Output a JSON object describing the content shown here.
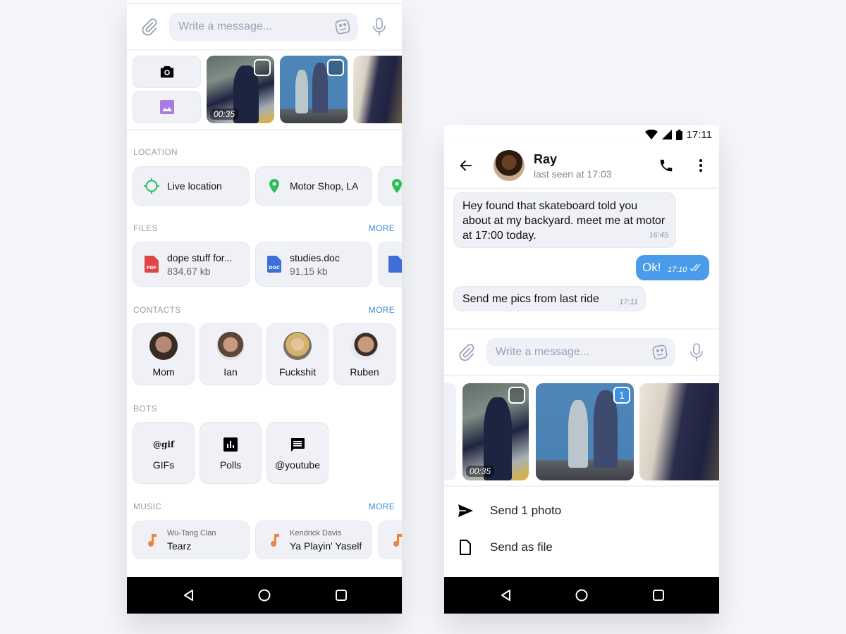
{
  "left_phone": {
    "composer": {
      "placeholder": "Write a message...",
      "attach_icon": "paperclip-icon",
      "sticker_icon": "sticker-icon",
      "mic_icon": "microphone-icon"
    },
    "media": {
      "camera_icon": "camera-icon",
      "gallery_icon": "image-icon",
      "thumbnails": [
        {
          "kind": "video",
          "duration": "00:35",
          "selected": false
        },
        {
          "kind": "photo",
          "selected": false
        },
        {
          "kind": "photo",
          "selected": false
        }
      ]
    },
    "location": {
      "title": "LOCATION",
      "items": [
        {
          "icon": "crosshair-icon",
          "label": "Live location"
        },
        {
          "icon": "map-pin-icon",
          "label": "Motor Shop, LA"
        }
      ]
    },
    "files": {
      "title": "FILES",
      "more": "MORE",
      "items": [
        {
          "icon": "pdf-file-icon",
          "type": "PDF",
          "name": "dope stuff for...",
          "size": "834,67 kb"
        },
        {
          "icon": "doc-file-icon",
          "type": "DOC",
          "name": "studies.doc",
          "size": "91,15 kb"
        }
      ]
    },
    "contacts": {
      "title": "CONTACTS",
      "more": "MORE",
      "items": [
        {
          "name": "Mom"
        },
        {
          "name": "Ian"
        },
        {
          "name": "Fuckshit"
        },
        {
          "name": "Ruben"
        }
      ]
    },
    "bots": {
      "title": "BOTS",
      "items": [
        {
          "icon_text": "@gif",
          "label": "GIFs"
        },
        {
          "icon": "bar-chart-icon",
          "label": "Polls"
        },
        {
          "icon": "chat-message-icon",
          "label": "@youtube"
        }
      ]
    },
    "music": {
      "title": "MUSIC",
      "more": "MORE",
      "items": [
        {
          "artist": "Wu-Tang Clan",
          "title": "Tearz"
        },
        {
          "artist": "Kendrick Davis",
          "title": "Ya Playin' Yaself"
        }
      ]
    }
  },
  "right_phone": {
    "status_bar": {
      "time": "17:11"
    },
    "header": {
      "name": "Ray",
      "status": "last seen at 17:03"
    },
    "messages": [
      {
        "direction": "in",
        "text": "Hey found that skateboard told you about at my backyard. meet me at motor at 17:00 today.",
        "time": "16:45"
      },
      {
        "direction": "out",
        "text": "Ok!",
        "time": "17:10",
        "read": true
      },
      {
        "direction": "in",
        "text": "Send me pics from last ride",
        "time": "17:11"
      }
    ],
    "composer": {
      "placeholder": "Write a message..."
    },
    "media": {
      "thumbnails": [
        {
          "kind": "video",
          "duration": "00:35",
          "selected": false
        },
        {
          "kind": "photo",
          "selected": true,
          "selection_index": "1"
        },
        {
          "kind": "photo",
          "selected": false
        }
      ]
    },
    "actions": [
      {
        "icon": "send-icon",
        "label": "Send 1 photo"
      },
      {
        "icon": "file-icon",
        "label": "Send as file"
      }
    ]
  },
  "colors": {
    "accent": "#3d8fe0",
    "bubble_out": "#4a9bea",
    "card_bg": "#eff1f6",
    "location_green": "#2ebd59",
    "pdf_red": "#e04444",
    "doc_blue": "#3e6fd8",
    "music_orange": "#f0823a",
    "gallery_purple": "#a77be0"
  }
}
